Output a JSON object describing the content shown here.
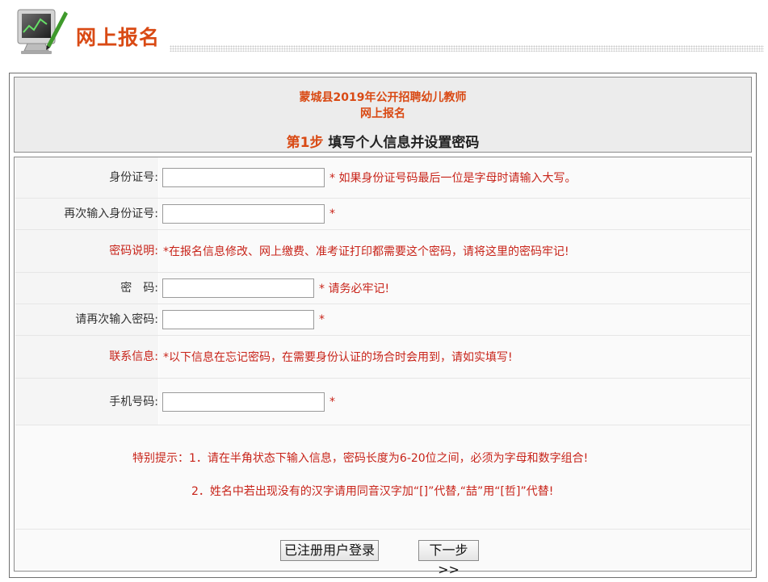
{
  "header": {
    "title": "网上报名"
  },
  "notice": {
    "org_line": "蒙城县2019年公开招聘幼儿教师",
    "sub_line": "网上报名",
    "step_num": "第1步",
    "step_text": " 填写个人信息并设置密码"
  },
  "form": {
    "id_label": "身份证号:",
    "id_note": "* 如果身份证号码最后一位是字母时请输入大写。",
    "id_confirm_label": "再次输入身份证号:",
    "id_confirm_note": "*",
    "pwd_desc_label": "密码说明:",
    "pwd_desc_text": "*在报名信息修改、网上缴费、准考证打印都需要这个密码，请将这里的密码牢记!",
    "pwd_label": "密　码:",
    "pwd_note": "* 请务必牢记!",
    "pwd_confirm_label": "请再次输入密码:",
    "pwd_confirm_note": "*",
    "contact_label": "联系信息:",
    "contact_text": "*以下信息在忘记密码，在需要身份认证的场合时会用到，请如实填写!",
    "phone_label": "手机号码:",
    "phone_note": "*"
  },
  "tips": {
    "line1": "特别提示：1．请在半角状态下输入信息，密码长度为6-20位之间，必须为字母和数字组合!",
    "line2": "2．姓名中若出现没有的汉字请用同音汉字加“[]”代替,“喆”用“[哲]”代替!"
  },
  "buttons": {
    "login": "已注册用户登录",
    "next": "下一步>>"
  },
  "colors": {
    "accent": "#d94a14",
    "warning_red": "#c8241a"
  },
  "icons": {
    "logo": "monitor-chart-icon"
  }
}
